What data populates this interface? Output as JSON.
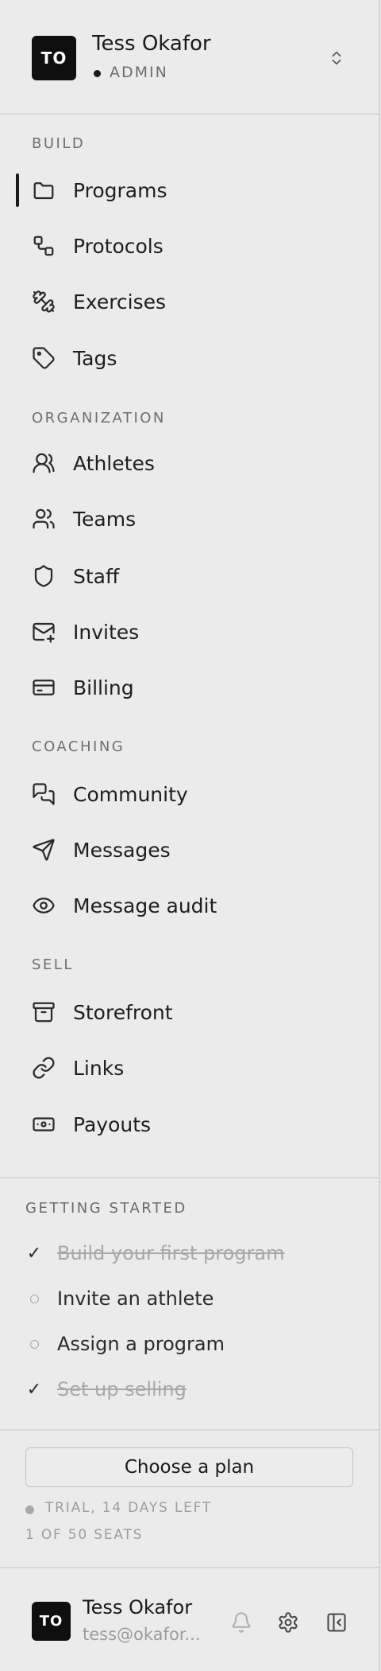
{
  "account": {
    "initials": "TO",
    "name": "Tess Okafor",
    "role": "ADMIN"
  },
  "sections": {
    "build": "BUILD",
    "organization": "ORGANIZATION",
    "coaching": "COACHING",
    "sell": "SELL"
  },
  "nav": {
    "programs": "Programs",
    "protocols": "Protocols",
    "exercises": "Exercises",
    "tags": "Tags",
    "athletes": "Athletes",
    "teams": "Teams",
    "staff": "Staff",
    "invites": "Invites",
    "billing": "Billing",
    "community": "Community",
    "messages": "Messages",
    "message_audit": "Message audit",
    "storefront": "Storefront",
    "links": "Links",
    "payouts": "Payouts"
  },
  "active_item": "Programs",
  "getting_started": {
    "title": "GETTING STARTED",
    "tasks": [
      {
        "label": "Build your first program",
        "done": true
      },
      {
        "label": "Invite an athlete",
        "done": false
      },
      {
        "label": "Assign a program",
        "done": false
      },
      {
        "label": "Set up selling",
        "done": true
      }
    ]
  },
  "plan": {
    "button_label": "Choose a plan",
    "trial_status": "TRIAL, 14 DAYS LEFT",
    "seats": "1 OF 50 SEATS"
  },
  "footer": {
    "initials": "TO",
    "name": "Tess Okafor",
    "email": "tess@okafor..."
  },
  "icons": [
    "chevrons-up-down-icon",
    "folder-icon",
    "workflow-icon",
    "dumbbell-icon",
    "tag-icon",
    "users-round-icon",
    "users-icon",
    "shield-icon",
    "mail-plus-icon",
    "credit-card-icon",
    "messages-square-icon",
    "send-icon",
    "eye-icon",
    "archive-icon",
    "link-icon",
    "banknote-icon",
    "bell-icon",
    "gear-icon",
    "panel-left-close-icon"
  ],
  "colors": {
    "background": "#ebebeb",
    "avatar": "#0f0f0f",
    "text": "#1e1e1e",
    "muted": "#6f6f6f",
    "done_task": "#a8a8a8"
  }
}
